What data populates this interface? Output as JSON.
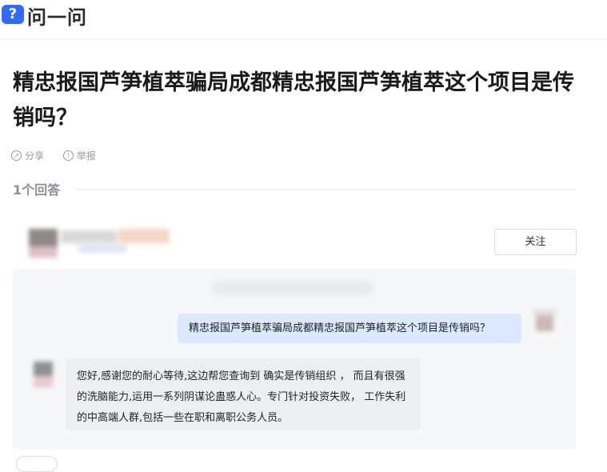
{
  "app": {
    "logo_glyph": "?",
    "logo_text": "问一问",
    "brand_color": "#2f6bff"
  },
  "question": {
    "title": "精忠报国芦笋植萃骗局成都精忠报国芦笋植萃这个项目是传销吗？",
    "share_label": "分享",
    "report_label": "举报"
  },
  "answers": {
    "count_label": "1个回答",
    "follow_label": "关注",
    "chat": {
      "user_message": "精忠报国芦笋植萃骗局成都精忠报国芦笋植萃这个项目是传销吗？",
      "agent_message": "您好,感谢您的耐心等待,这边帮您查询到 确实是传销组织 ， 而且有很强的洗脑能力,运用一系列阴谋论蛊惑人心。专门针对投资失败， 工作失利的中高端人群,包括一些在职和离职公务人员。"
    }
  },
  "icons": {
    "share": "share-icon",
    "report": "report-icon"
  }
}
